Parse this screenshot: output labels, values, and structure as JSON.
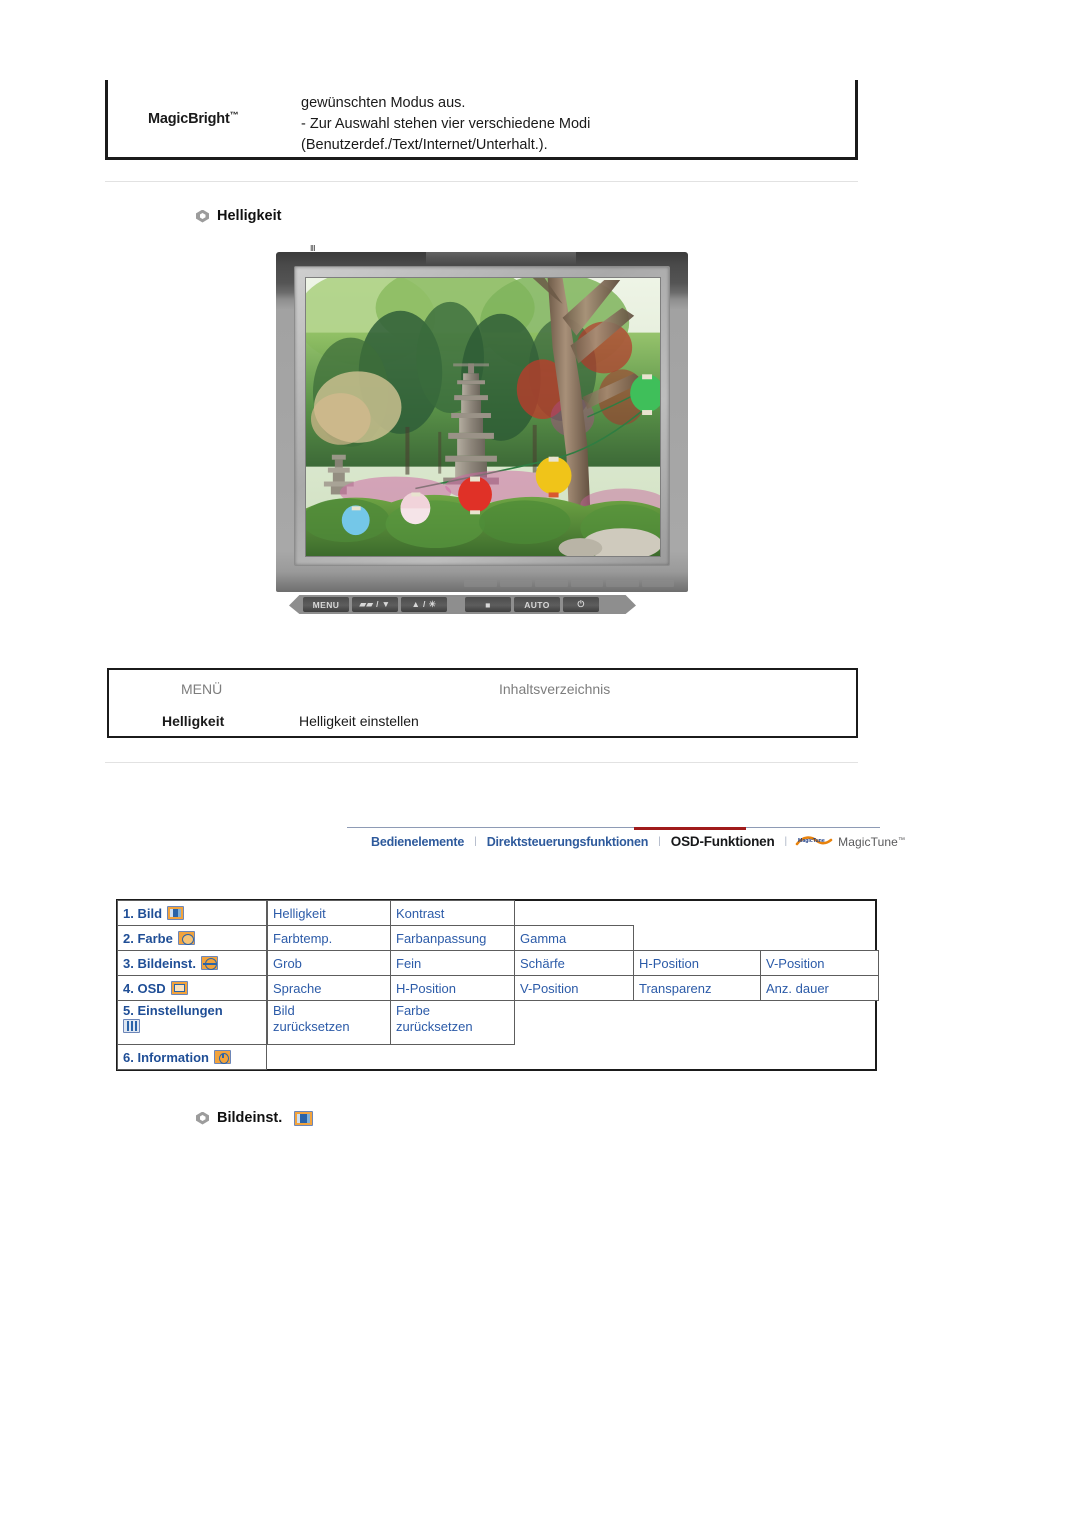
{
  "magicbright": {
    "label": "MagicBright",
    "tm": "™",
    "description": "gewünschten Modus aus.\n- Zur Auswahl stehen vier verschiedene Modi\n(Benutzerdef./Text/Internet/Unterhalt.)."
  },
  "section_brightness": {
    "heading": "Helligkeit"
  },
  "monitor": {
    "buttons": {
      "menu": "MENU",
      "down": "▰▰ / ▼",
      "up": "▲ / ☀",
      "enter": "■",
      "auto": "AUTO",
      "power": "⏻"
    },
    "menu_dots": "Ⅲ"
  },
  "menu_table": {
    "headers": [
      "MENÜ",
      "Inhaltsverzeichnis"
    ],
    "rows": [
      {
        "menu": "Helligkeit",
        "contents": "Helligkeit einstellen"
      }
    ]
  },
  "navbar": {
    "tabs": [
      {
        "label": "Bedienelemente",
        "active": false
      },
      {
        "label": "Direktsteuerungsfunktionen",
        "active": false
      },
      {
        "label": "OSD-Funktionen",
        "active": true
      }
    ],
    "separator": "|",
    "logo_text": "MagicTune",
    "logo_tm": "™",
    "accent_color": "#a01b1b",
    "link_color": "#2e5a9c"
  },
  "osd_grid": {
    "rows": [
      {
        "label": "1. Bild",
        "icon": "picture-icon",
        "items": [
          "Helligkeit",
          "Kontrast"
        ]
      },
      {
        "label": "2. Farbe",
        "icon": "color-icon",
        "items": [
          "Farbtemp.",
          "Farbanpassung",
          "Gamma"
        ]
      },
      {
        "label": "3. Bildeinst.",
        "icon": "geometry-icon",
        "items": [
          "Grob",
          "Fein",
          "Schärfe",
          "H-Position",
          "V-Position"
        ]
      },
      {
        "label": "4. OSD",
        "icon": "osd-icon",
        "items": [
          "Sprache",
          "H-Position",
          "V-Position",
          "Transparenz",
          "Anz. dauer"
        ]
      },
      {
        "label": "5. Einstellungen",
        "icon": "setup-icon",
        "items": [
          "Bild\nzurücksetzen",
          "Farbe\nzurücksetzen"
        ]
      },
      {
        "label": "6. Information",
        "icon": "info-icon",
        "items": []
      }
    ]
  },
  "section_bildeinst": {
    "heading": "Bildeinst.",
    "icon": "picture-icon"
  }
}
